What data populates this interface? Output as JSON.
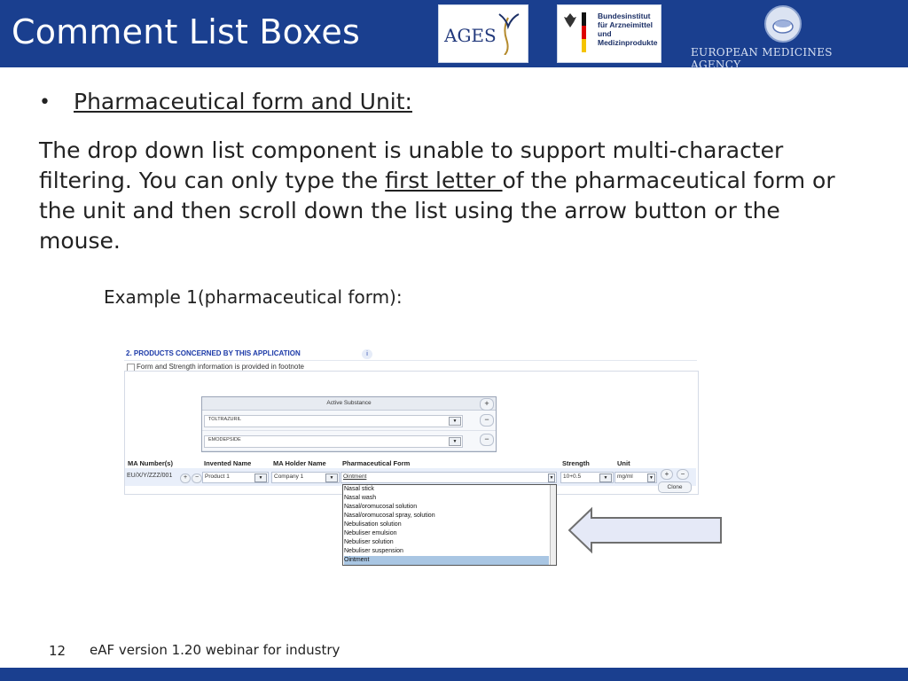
{
  "slide": {
    "title": "Comment List Boxes",
    "bullet": "•",
    "heading": "Pharmaceutical form and Unit:",
    "paragraph": {
      "part1": "The drop down list component is unable to support multi-character filtering. You can only type the ",
      "underlined": "first letter ",
      "part2": "of the pharmaceutical form or the unit and then scroll down the list using the arrow button or the mouse."
    },
    "example_label": "Example 1(pharmaceutical form):",
    "page_number": "12",
    "footer_text": "eAF version 1.20 webinar for industry"
  },
  "logos": {
    "ages": "AGES",
    "bfarm": "Bundesinstitut\nfür Arzneimittel\nund Medizinprodukte",
    "ema": "European Medicines Agency"
  },
  "form": {
    "section_title": "2.  PRODUCTS CONCERNED BY THIS APPLICATION",
    "info": "i",
    "footnote_checkbox": "Form and Strength information is provided in footnote",
    "active_substance_header": "Active Substance",
    "substances": [
      "TOLTRAZURIL",
      "EMODEPSIDE"
    ],
    "add_symbol": "+",
    "remove_symbol": "−",
    "columns": {
      "ma_number": "MA Number(s)",
      "invented_name": "Invented Name",
      "ma_holder": "MA Holder Name",
      "pharm_form": "Pharmaceutical Form",
      "strength": "Strength",
      "unit": "Unit"
    },
    "row": {
      "ma_number": "EU/X/Y/ZZZ/001",
      "invented_name": "Product 1",
      "ma_holder": "Company 1",
      "pharm_form": "Ointment",
      "strength": "10+0.5",
      "unit": "mg/ml"
    },
    "clone": "Clone",
    "dropdown_items": [
      "Nasal stick",
      "Nasal wash",
      "Nasal/oromucosal solution",
      "Nasal/oromucosal spray, solution",
      "Nebulisation solution",
      "Nebuliser emulsion",
      "Nebuliser solution",
      "Nebuliser suspension",
      "Ointment"
    ],
    "selected_item": "Ointment"
  },
  "colors": {
    "brand_blue": "#1a3f8f",
    "selection": "#a9c6e3",
    "arrow_fill": "#e5e9f7"
  }
}
